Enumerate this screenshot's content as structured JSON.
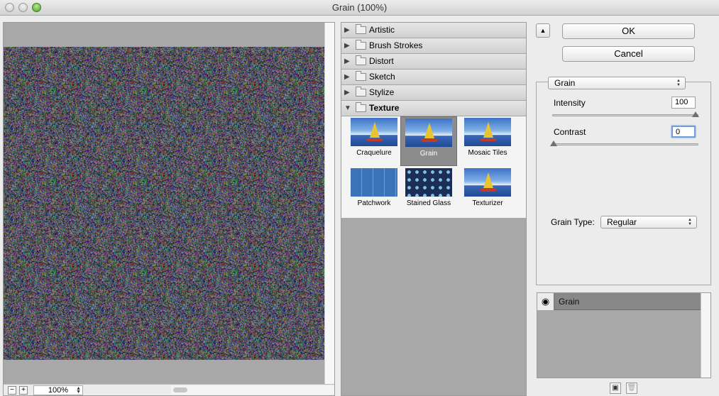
{
  "window": {
    "title": "Grain (100%)"
  },
  "preview": {
    "zoom": "100%",
    "zoom_out": "−",
    "zoom_in": "+"
  },
  "categories": [
    {
      "label": "Artistic",
      "expanded": false
    },
    {
      "label": "Brush Strokes",
      "expanded": false
    },
    {
      "label": "Distort",
      "expanded": false
    },
    {
      "label": "Sketch",
      "expanded": false
    },
    {
      "label": "Stylize",
      "expanded": false
    },
    {
      "label": "Texture",
      "expanded": true
    }
  ],
  "texture_filters": [
    "Craquelure",
    "Grain",
    "Mosaic Tiles",
    "Patchwork",
    "Stained Glass",
    "Texturizer"
  ],
  "selected_filter": "Grain",
  "buttons": {
    "ok": "OK",
    "cancel": "Cancel",
    "collapse": "▲"
  },
  "settings": {
    "filter": "Grain",
    "intensity_label": "Intensity",
    "intensity_value": "100",
    "intensity_level": 1.0,
    "contrast_label": "Contrast",
    "contrast_value": "0",
    "contrast_level": 0.0,
    "grain_type_label": "Grain Type:",
    "grain_type_value": "Regular"
  },
  "layers": {
    "name": "Grain"
  }
}
